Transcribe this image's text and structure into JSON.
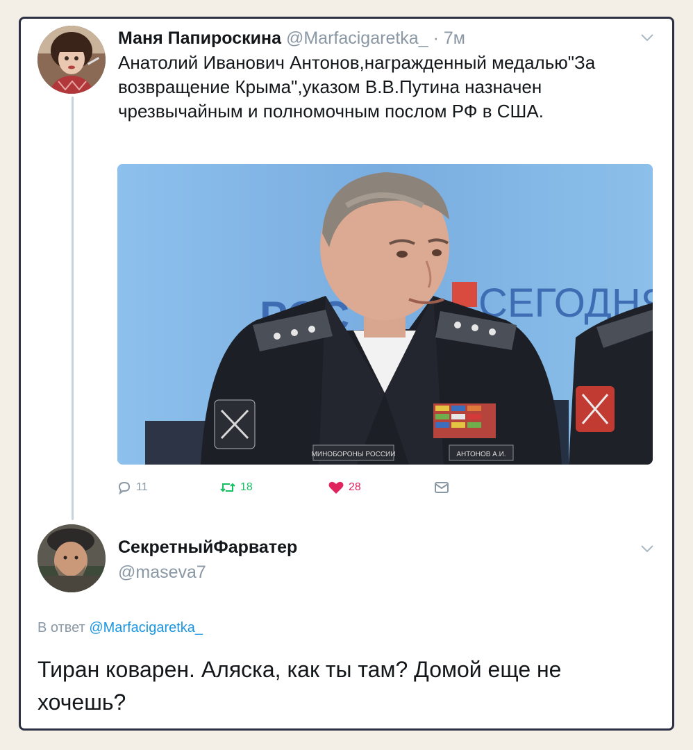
{
  "tweet": {
    "author_name": "Маня Папироскина",
    "author_handle": "@Marfacigaretka_",
    "time": "· 7м",
    "text": "Анатолий Иванович Антонов,награжденный медалью\"За возвращение Крыма\",указом В.В.Путина назначен чрезвычайным и полномочным послом РФ в США.",
    "photo": {
      "backdrop_text": "СЕГОДНЯ",
      "backdrop_text_left": "РОС",
      "patch_text": "МИНОБОРОНЫ РОССИИ",
      "name_tag": "АНТОНОВ А.И."
    },
    "actions": {
      "replies": "11",
      "retweets": "18",
      "likes": "28"
    }
  },
  "reply": {
    "author_name": "СекретныйФарватер",
    "author_handle": "@maseva7",
    "reply_to_prefix": "В ответ",
    "reply_to_handle": "@Marfacigaretka_",
    "text": "Тиран коварен. Аляска, как ты там? Домой еще не хочешь?"
  },
  "colors": {
    "frame": "#2b3043",
    "background": "#f3efe6",
    "handle_gray": "#8a97a4",
    "link_blue": "#1b95e0",
    "retweet_green": "#17bf63",
    "like_pink": "#e0245e",
    "thread_line": "#c6d3dd"
  },
  "icons": [
    "reply-icon",
    "retweet-icon",
    "heart-icon",
    "direct-message-icon",
    "chevron-down-icon"
  ]
}
